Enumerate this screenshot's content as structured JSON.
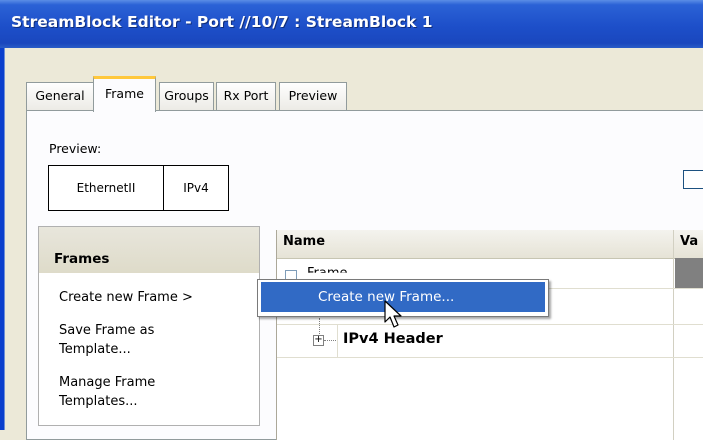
{
  "window": {
    "title": "StreamBlock Editor - Port //10/7 : StreamBlock 1"
  },
  "tabs": [
    {
      "label": "General"
    },
    {
      "label": "Frame",
      "active": true
    },
    {
      "label": "Groups"
    },
    {
      "label": "Rx Port"
    },
    {
      "label": "Preview"
    }
  ],
  "preview": {
    "label": "Preview:",
    "items": [
      "EthernetII",
      "IPv4"
    ]
  },
  "frames_panel": {
    "header": "Frames",
    "items": [
      {
        "label": "Create new Frame >"
      },
      {
        "label": "Save Frame as Template..."
      },
      {
        "label": "Manage Frame Templates..."
      }
    ]
  },
  "tree": {
    "columns": [
      "Name",
      "Va"
    ],
    "rows": [
      {
        "label": "Frame"
      },
      {
        "label": "IPv4 Header"
      }
    ]
  },
  "context_menu": {
    "items": [
      {
        "label": "Create new Frame..."
      }
    ]
  },
  "colors": {
    "title_bar": "#1d4fc9",
    "active_tab_accent": "#ffc83c",
    "menu_highlight": "#316ac5"
  },
  "icons": [
    "plus-expand-icon",
    "mouse-cursor-icon"
  ]
}
